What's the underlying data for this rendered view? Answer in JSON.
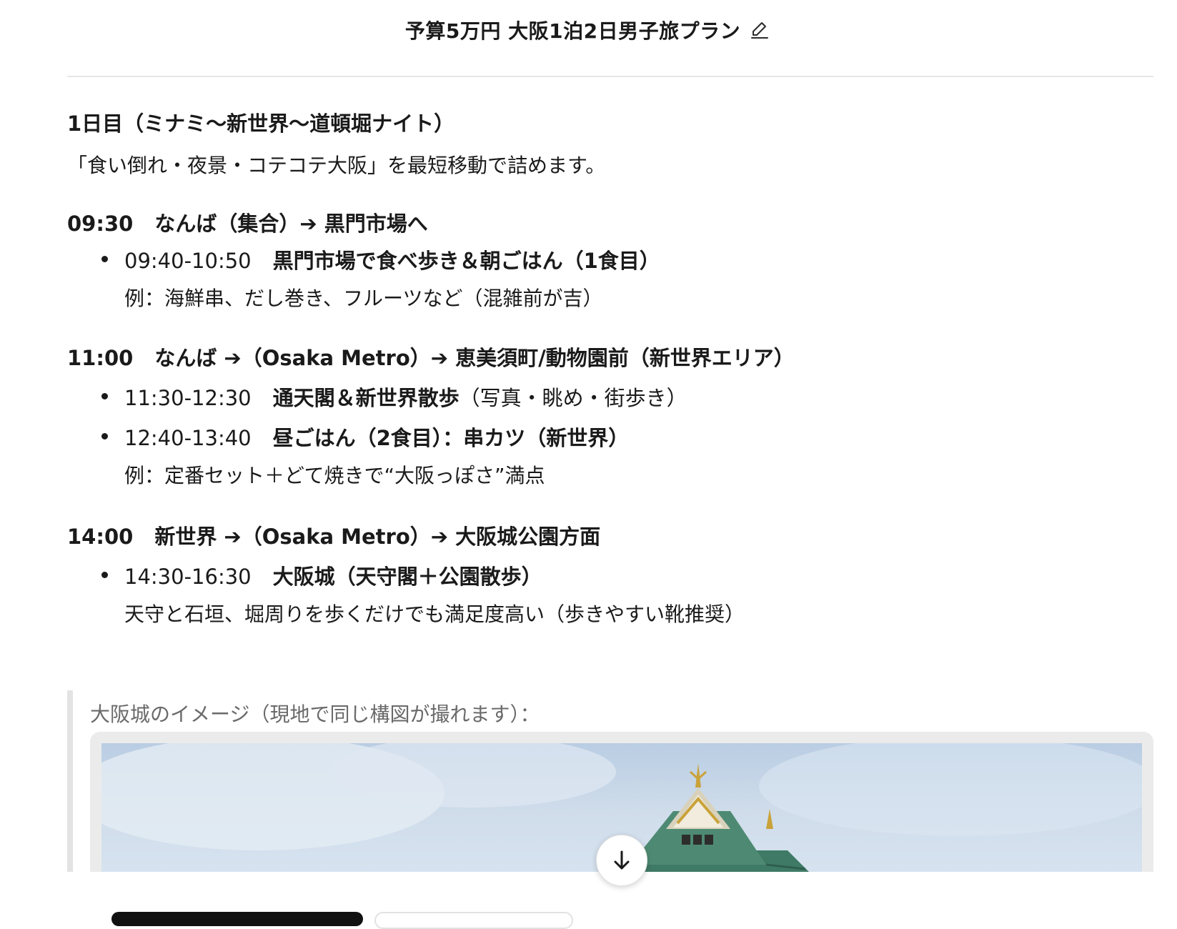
{
  "header": {
    "title": "予算5万円 大阪1泊2日男子旅プラン",
    "edit_icon": "pencil-icon"
  },
  "plan": {
    "day_title": "1日目（ミナミ〜新世界〜道頓堀ナイト）",
    "intro": "「食い倒れ・夜景・コテコテ大阪」を最短移動で詰めます。",
    "sections": [
      {
        "time": "09:30",
        "heading": "なんば（集合）➔ 黒門市場へ",
        "items": [
          {
            "time": "09:40-10:50",
            "activity": "黒門市場で食べ歩き＆朝ごはん（1食目）",
            "extra": "",
            "note": "例：海鮮串、だし巻き、フルーツなど（混雑前が吉）"
          }
        ]
      },
      {
        "time": "11:00",
        "heading": "なんば ➔（Osaka Metro）➔ 恵美須町/動物園前（新世界エリア）",
        "items": [
          {
            "time": "11:30-12:30",
            "activity": "通天閣＆新世界散歩",
            "extra": "（写真・眺め・街歩き）",
            "note": ""
          },
          {
            "time": "12:40-13:40",
            "activity": "昼ごはん（2食目）：串カツ（新世界）",
            "extra": "",
            "note": "例：定番セット＋どて焼きで“大阪っぽさ”満点"
          }
        ]
      },
      {
        "time": "14:00",
        "heading": "新世界 ➔（Osaka Metro）➔ 大阪城公園方面",
        "items": [
          {
            "time": "14:30-16:30",
            "activity": "大阪城（天守閣＋公園散歩）",
            "extra": "",
            "note": "天守と石垣、堀周りを歩くだけでも満足度高い（歩きやすい靴推奨）"
          }
        ]
      }
    ]
  },
  "image_block": {
    "caption": "大阪城のイメージ（現地で同じ構図が撮れます）："
  },
  "controls": {
    "scroll_icon": "arrow-down-icon"
  },
  "colors": {
    "text": "#1a1a1a",
    "muted": "#6a6a6a",
    "roof_green": "#4e8a73",
    "gold": "#c9a23a",
    "sky": "#cfdcea"
  }
}
